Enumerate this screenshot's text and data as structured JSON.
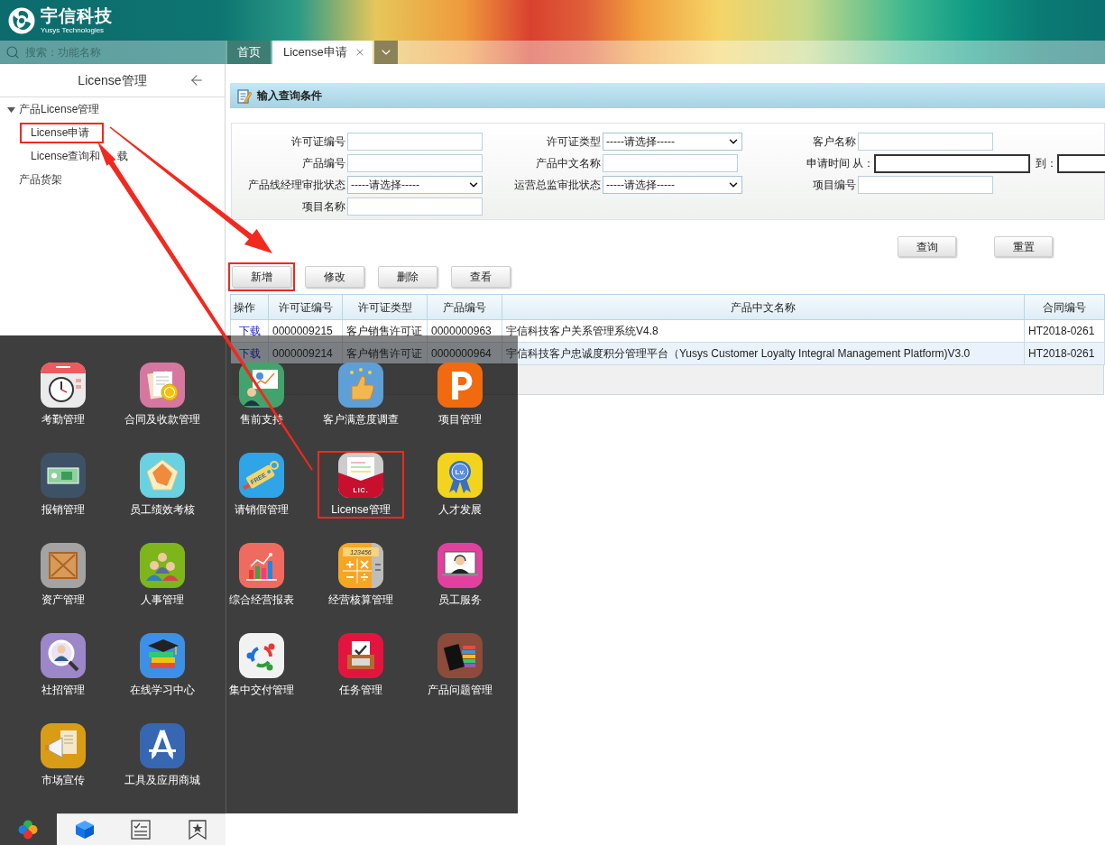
{
  "header": {
    "logo_title": "宇信科技",
    "logo_subtitle": "Yusys Technologies"
  },
  "search": {
    "placeholder": "搜索：功能名称"
  },
  "tabs": [
    {
      "label": "首页",
      "selected": false,
      "closable": false
    },
    {
      "label": "License申请",
      "selected": true,
      "closable": true
    }
  ],
  "sidebar": {
    "title": "License管理",
    "tree": [
      {
        "label": "产品License管理",
        "expanded": true,
        "children": [
          {
            "label": "License申请",
            "highlighted": true
          },
          {
            "label": "License查询和 载",
            "highlighted": false
          }
        ]
      },
      {
        "label": "产品货架"
      }
    ]
  },
  "query_panel": {
    "title": "输入查询条件",
    "rows": [
      [
        {
          "kind": "text",
          "label": "许可证编号"
        },
        {
          "kind": "select",
          "label": "许可证类型",
          "value": "-----请选择-----"
        },
        {
          "kind": "text",
          "label": "客户名称"
        }
      ],
      [
        {
          "kind": "text",
          "label": "产品编号"
        },
        {
          "kind": "text",
          "label": "产品中文名称"
        },
        {
          "kind": "date_range",
          "label": "申请时间",
          "from_label": "从：",
          "to_label": "到："
        }
      ],
      [
        {
          "kind": "select",
          "label": "产品线经理审批状态",
          "value": "-----请选择-----"
        },
        {
          "kind": "select",
          "label": "运营总监审批状态",
          "value": "-----请选择-----"
        },
        {
          "kind": "text",
          "label": "项目编号"
        }
      ],
      [
        {
          "kind": "text",
          "label": "项目名称"
        }
      ]
    ],
    "buttons": [
      "查询",
      "重置"
    ]
  },
  "actions": [
    {
      "label": "新增",
      "highlighted": true
    },
    {
      "label": "修改",
      "highlighted": false
    },
    {
      "label": "删除",
      "highlighted": false
    },
    {
      "label": "查看",
      "highlighted": false
    }
  ],
  "table": {
    "columns": [
      "操作",
      "许可证编号",
      "许可证类型",
      "产品编号",
      "产品中文名称",
      "合同编号"
    ],
    "rows": [
      {
        "cells": [
          "下载",
          "0000009215",
          "客户销售许可证",
          "0000000963",
          "宇信科技客户关系管理系统V4.8",
          "HT2018-0261"
        ]
      },
      {
        "cells": [
          "下载",
          "0000009214",
          "客户销售许可证",
          "0000000964",
          "宇信科技客户忠诚度积分管理平台（Yusys Customer Loyalty Integral Management Platform)V3.0",
          "HT2018-0261"
        ]
      }
    ]
  },
  "launcher": {
    "apps": [
      {
        "label": "考勤管理",
        "highlighted": false
      },
      {
        "label": "合同及收款管理",
        "highlighted": false
      },
      {
        "label": "售前支持",
        "highlighted": false
      },
      {
        "label": "客户满意度调查",
        "highlighted": false
      },
      {
        "label": "项目管理",
        "highlighted": false
      },
      {
        "label": "报销管理",
        "highlighted": false
      },
      {
        "label": "员工绩效考核",
        "highlighted": false
      },
      {
        "label": "请销假管理",
        "highlighted": false,
        "icon_text": "FREE"
      },
      {
        "label": "License管理",
        "highlighted": true,
        "icon_text": "LIC."
      },
      {
        "label": "人才发展",
        "highlighted": false,
        "icon_text": "Lv."
      },
      {
        "label": "资产管理",
        "highlighted": false
      },
      {
        "label": "人事管理",
        "highlighted": false
      },
      {
        "label": "综合经营报表",
        "highlighted": false
      },
      {
        "label": "经营核算管理",
        "highlighted": false,
        "icon_text": "123456"
      },
      {
        "label": "员工服务",
        "highlighted": false
      },
      {
        "label": "社招管理",
        "highlighted": false
      },
      {
        "label": "在线学习中心",
        "highlighted": false
      },
      {
        "label": "集中交付管理",
        "highlighted": false
      },
      {
        "label": "任务管理",
        "highlighted": false
      },
      {
        "label": "产品问题管理",
        "highlighted": false
      },
      {
        "label": "市场宣传",
        "highlighted": false
      },
      {
        "label": "工具及应用商城",
        "highlighted": false
      }
    ],
    "dock": [
      {
        "selected": true
      },
      {
        "selected": false
      },
      {
        "selected": false
      },
      {
        "selected": false
      }
    ]
  }
}
